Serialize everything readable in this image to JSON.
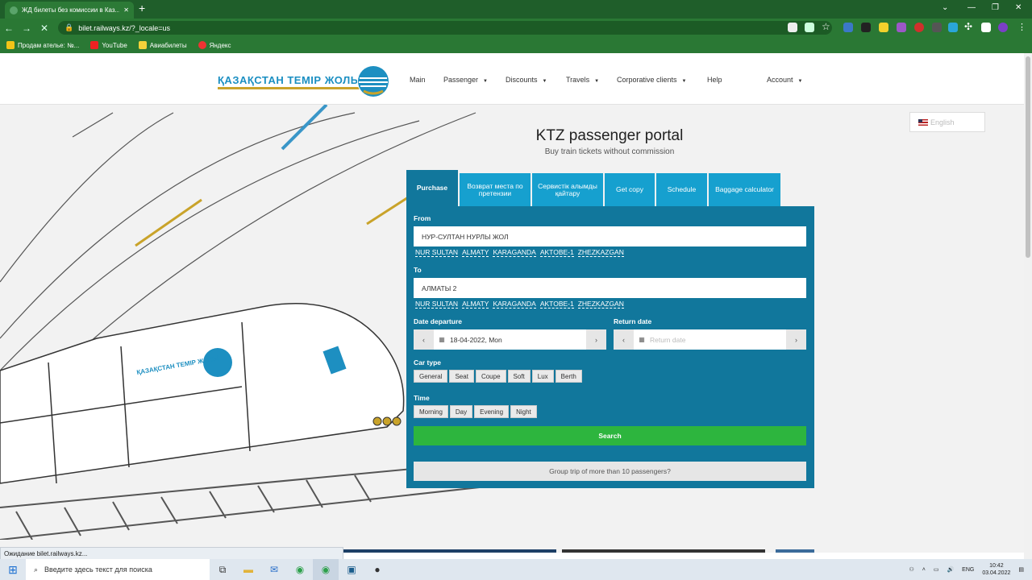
{
  "browser": {
    "tab_title": "ЖД билеты без комиссии в Каз...",
    "url": "bilet.railways.kz/?_locale=us",
    "bookmarks": [
      "Продам ателье: №...",
      "YouTube",
      "Авиабилеты",
      "Яндекс"
    ]
  },
  "site": {
    "logo_text": "ҚАЗАҚСТАН ТЕМІР ЖОЛЫ",
    "nav": {
      "main": "Main",
      "passenger": "Passenger",
      "discounts": "Discounts",
      "travels": "Travels",
      "corporative": "Corporative clients",
      "help": "Help",
      "account": "Account"
    },
    "language": "English",
    "title": "KTZ passenger portal",
    "subtitle": "Buy train tickets without commission"
  },
  "form": {
    "tabs": {
      "purchase": "Purchase",
      "refund": "Возврат места по претензии",
      "service": "Сервистік алымды қайтару",
      "copy": "Get copy",
      "schedule": "Schedule",
      "baggage": "Baggage calculator"
    },
    "from_label": "From",
    "from_value": "НУР-СУЛТАН НУРЛЫ ЖОЛ",
    "to_label": "To",
    "to_value": "АЛМАТЫ 2",
    "quick_cities": [
      "NUR SULTAN",
      "ALMATY",
      "KARAGANDA",
      "AKTOBE-1",
      "ZHEZKAZGAN"
    ],
    "departure_label": "Date departure",
    "departure_value": "18-04-2022, Mon",
    "return_label": "Return date",
    "return_placeholder": "Return date",
    "car_type_label": "Car type",
    "car_types": [
      "General",
      "Seat",
      "Coupe",
      "Soft",
      "Lux",
      "Berth"
    ],
    "time_label": "Time",
    "times": [
      "Morning",
      "Day",
      "Evening",
      "Night"
    ],
    "search": "Search",
    "group_trip": "Group trip of more than 10 passengers?"
  },
  "status_text": "Ожидание bilet.railways.kz...",
  "taskbar": {
    "search_placeholder": "Введите здесь текст для поиска",
    "lang": "ENG",
    "time": "10:42",
    "date": "03.04.2022"
  },
  "colors": {
    "chrome": "#2a7834",
    "tab_blue": "#16a0cf",
    "panel": "#11779c",
    "search_green": "#2db53e"
  }
}
